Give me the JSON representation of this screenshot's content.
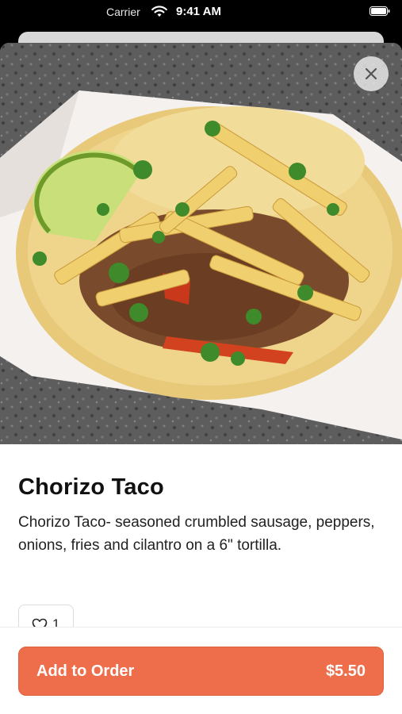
{
  "status_bar": {
    "carrier": "Carrier",
    "time": "9:41 AM",
    "icons": [
      "wifi-icon",
      "battery-icon"
    ]
  },
  "item": {
    "image_alt": "Chorizo taco with fries, cilantro and lime",
    "title": "Chorizo Taco",
    "description": "Chorizo Taco- seasoned crumbled sausage, peppers, onions, fries and cilantro on a 6\" tortilla.",
    "likes": "1"
  },
  "actions": {
    "close_icon": "close-icon",
    "like_icon": "heart-icon"
  },
  "order": {
    "label": "Add to Order",
    "price": "$5.50"
  },
  "colors": {
    "accent": "#ee6d4a",
    "text": "#111111"
  }
}
